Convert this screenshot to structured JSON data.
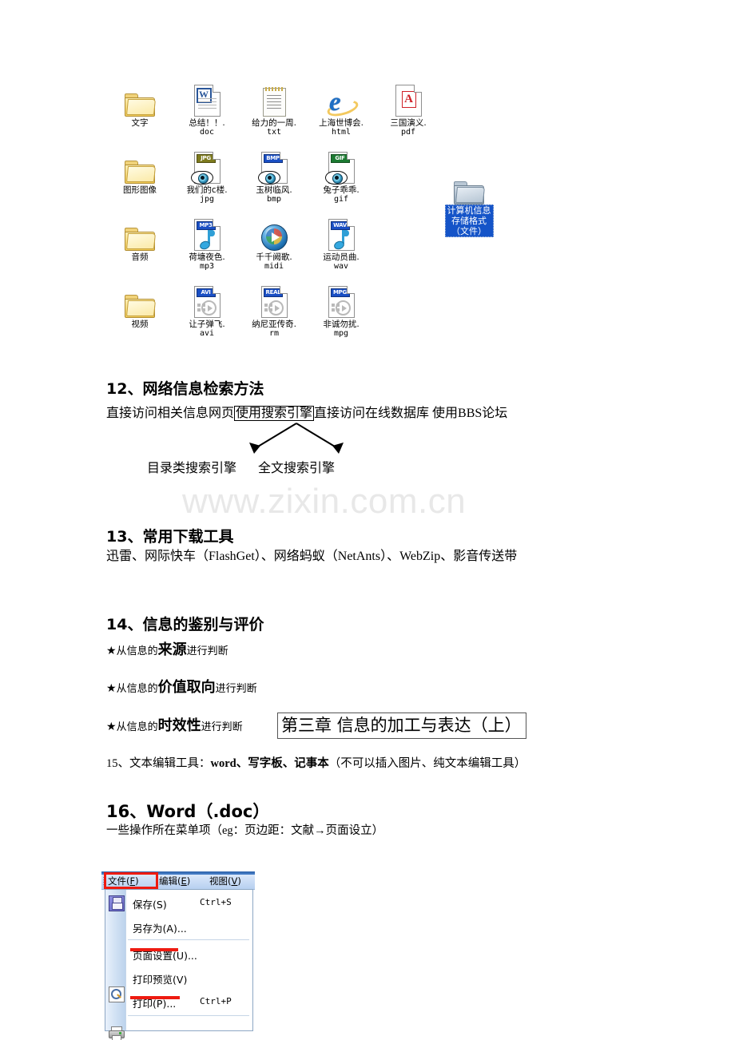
{
  "watermark": "www.zixin.com.cn",
  "desktop": {
    "rows": [
      [
        {
          "icon": "folder-icon",
          "name": "文字",
          "ext": ""
        },
        {
          "icon": "word-doc-icon",
          "name": "总结！！.",
          "ext": "doc"
        },
        {
          "icon": "notepad-txt-icon",
          "name": "给力的一周.",
          "ext": "txt"
        },
        {
          "icon": "internet-explorer-html-icon",
          "name": "上海世博会.",
          "ext": "html"
        },
        {
          "icon": "pdf-icon",
          "name": "三国演义.",
          "ext": "pdf"
        }
      ],
      [
        {
          "icon": "folder-icon",
          "name": "图形图像",
          "ext": ""
        },
        {
          "icon": "jpg-image-icon",
          "name": "我们的c楼.",
          "ext": "jpg",
          "badge": "JPG",
          "badge_color": "#7d7a1e"
        },
        {
          "icon": "bmp-image-icon",
          "name": "玉树临风.",
          "ext": "bmp",
          "badge": "BMP",
          "badge_color": "#1a4fc4"
        },
        {
          "icon": "gif-image-icon",
          "name": "兔子乖乖.",
          "ext": "gif",
          "badge": "GIF",
          "badge_color": "#1c7a32"
        }
      ],
      [
        {
          "icon": "folder-icon",
          "name": "音频",
          "ext": ""
        },
        {
          "icon": "mp3-audio-icon",
          "name": "荷塘夜色.",
          "ext": "mp3",
          "badge": "MP3",
          "badge_color": "#1a4fc4"
        },
        {
          "icon": "midi-media-player-icon",
          "name": "千千阙歌.",
          "ext": "midi"
        },
        {
          "icon": "wav-audio-icon",
          "name": "运动员曲.",
          "ext": "wav",
          "badge": "WAV",
          "badge_color": "#1a4fc4"
        }
      ],
      [
        {
          "icon": "folder-icon",
          "name": "视频",
          "ext": ""
        },
        {
          "icon": "avi-video-icon",
          "name": "让子弹飞.",
          "ext": "avi",
          "badge": "AVI",
          "badge_color": "#1a4fc4"
        },
        {
          "icon": "rm-video-icon",
          "name": "纳尼亚传奇.",
          "ext": "rm",
          "badge": "REAL",
          "badge_color": "#1a4fc4"
        },
        {
          "icon": "mpg-video-icon",
          "name": "非诚勿扰.",
          "ext": "mpg",
          "badge": "MPG",
          "badge_color": "#1a4fc4"
        }
      ]
    ],
    "selected_folder": {
      "icon": "folder-icon-selected",
      "label_lines": [
        "计算机信息",
        "存储格式",
        "（文件）"
      ],
      "label_full": "计算机信息存储格式（文件）",
      "highlight_color": "#1554c8"
    }
  },
  "sections": {
    "s12": {
      "heading": "12、网络信息检索方法",
      "line_parts": {
        "before": "直接访问相关信息网页",
        "boxed": "使用搜索引擎",
        "after": "直接访问在线数据库 使用BBS论坛"
      },
      "branch_left": "目录类搜索引擎",
      "branch_right": "全文搜索引擎"
    },
    "s13": {
      "heading": "13、常用下载工具",
      "body": "迅雷、网际快车（FlashGet）、网络蚂蚁（NetAnts）、WebZip、影音传送带"
    },
    "s14": {
      "heading": "14、信息的鉴别与评价",
      "bullets": [
        {
          "star": "★",
          "pre": "从信息的",
          "key": "来源",
          "post": "进行判断"
        },
        {
          "star": "★",
          "pre": "从信息的",
          "key": "价值取向",
          "post": "进行判断"
        },
        {
          "star": "★",
          "pre": "从信息的",
          "key": "时效性",
          "post": "进行判断"
        }
      ]
    },
    "chapter_box": "第三章 信息的加工与表达（上）",
    "s15": {
      "prefix": "15、文本编辑工具：",
      "tools": "word、写字板、记事本",
      "suffix": "（不可以插入图片、纯文本编辑工具）"
    },
    "s16": {
      "heading": "16、Word（.doc）",
      "body": "一些操作所在菜单项（eg：页边距：文献→页面设立）"
    }
  },
  "word_menu_screenshot": {
    "menubar": [
      {
        "label": "文件",
        "accel": "F",
        "highlighted": true
      },
      {
        "label": "编辑",
        "accel": "E",
        "highlighted": false
      },
      {
        "label": "视图",
        "accel": "V",
        "highlighted": false
      }
    ],
    "highlight_color": "#ee1b11",
    "items": [
      {
        "icon": "save-floppy-icon",
        "label": "保存",
        "accel": "S",
        "shortcut": "Ctrl+S",
        "ellipsis": "",
        "underlined": false
      },
      {
        "icon": "",
        "label": "另存为",
        "accel": "A",
        "shortcut": "",
        "ellipsis": "...",
        "underlined": false
      },
      {
        "icon": "",
        "label": "页面设置",
        "accel": "U",
        "shortcut": "",
        "ellipsis": "...",
        "underlined": true
      },
      {
        "icon": "print-preview-icon",
        "label": "打印预览",
        "accel": "V",
        "shortcut": "",
        "ellipsis": "",
        "underlined": false
      },
      {
        "icon": "printer-icon",
        "label": "打印",
        "accel": "P",
        "shortcut": "Ctrl+P",
        "ellipsis": "...",
        "underlined": true
      }
    ]
  }
}
